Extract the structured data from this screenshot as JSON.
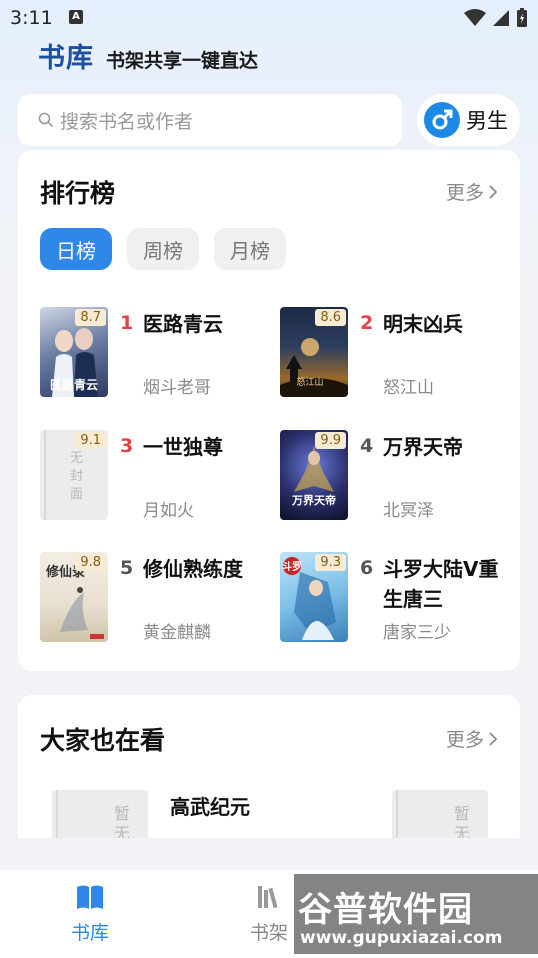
{
  "status_bar": {
    "time": "3:11",
    "notification_letter": "A"
  },
  "header": {
    "title": "书库",
    "slogan": "书架共享一键直达"
  },
  "search": {
    "placeholder": "搜索书名或作者"
  },
  "gender": {
    "label": "男生"
  },
  "ranking": {
    "title": "排行榜",
    "more": "更多",
    "tabs": [
      {
        "label": "日榜",
        "active": true
      },
      {
        "label": "周榜",
        "active": false
      },
      {
        "label": "月榜",
        "active": false
      }
    ],
    "books": [
      {
        "rank": "1",
        "title": "医路青云",
        "author": "烟斗老哥",
        "score": "8.7",
        "cover_text": "医路青云"
      },
      {
        "rank": "2",
        "title": "明末凶兵",
        "author": "怒江山",
        "score": "8.6",
        "cover_text": "怒江山"
      },
      {
        "rank": "3",
        "title": "一世独尊",
        "author": "月如火",
        "score": "9.1",
        "cover_text": "无封面"
      },
      {
        "rank": "4",
        "title": "万界天帝",
        "author": "北冥泽",
        "score": "9.9",
        "cover_text": "万界天帝"
      },
      {
        "rank": "5",
        "title": "修仙熟练度",
        "author": "黄金麒麟",
        "score": "9.8",
        "cover_text": "修仙录"
      },
      {
        "rank": "6",
        "title": "斗罗大陆V重生唐三",
        "author": "唐家三少",
        "score": "9.3",
        "cover_text": "斗罗"
      }
    ]
  },
  "also_watching": {
    "title": "大家也在看",
    "more": "更多",
    "book_title": "高武纪元",
    "cover_text": "暂无"
  },
  "bottom_nav": {
    "items": [
      {
        "label": "书库",
        "active": true
      },
      {
        "label": "书架",
        "active": false
      }
    ]
  },
  "watermark": {
    "logo": "谷普软件园",
    "url": "www.gupuxiazai.com"
  },
  "colors": {
    "accent": "#2f87e8",
    "rank_top": "#e04444",
    "header_blue": "#1d4fa0"
  }
}
